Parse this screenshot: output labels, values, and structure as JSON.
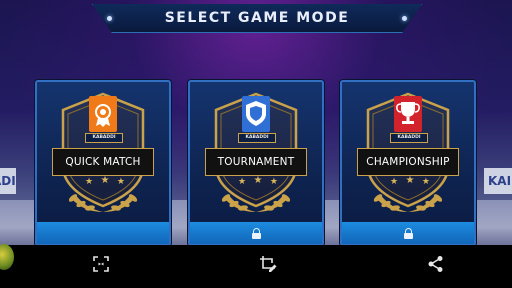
{
  "screen": {
    "title": "SELECT GAME MODE"
  },
  "background": {
    "ad_left": "ADI",
    "ad_right": "KAI"
  },
  "modes": [
    {
      "label": "QUICK MATCH",
      "badge_text": "KABADDI",
      "badge_color": "#f07a17",
      "badge_icon": "medal-icon",
      "locked": false
    },
    {
      "label": "TOURNAMENT",
      "badge_text": "KABADDI",
      "badge_color": "#2f6fd6",
      "badge_icon": "shield-icon",
      "locked": true
    },
    {
      "label": "CHAMPIONSHIP",
      "badge_text": "KABADDI",
      "badge_color": "#d2222c",
      "badge_icon": "trophy-icon",
      "locked": true
    }
  ],
  "colors": {
    "accent_gold": "#c9a24a",
    "card_border": "#2f6fc4",
    "footer_blue": "#1c8ce0"
  },
  "bottom_bar": {
    "icons": [
      "screenshot-icon",
      "edit-crop-icon",
      "share-icon"
    ]
  }
}
